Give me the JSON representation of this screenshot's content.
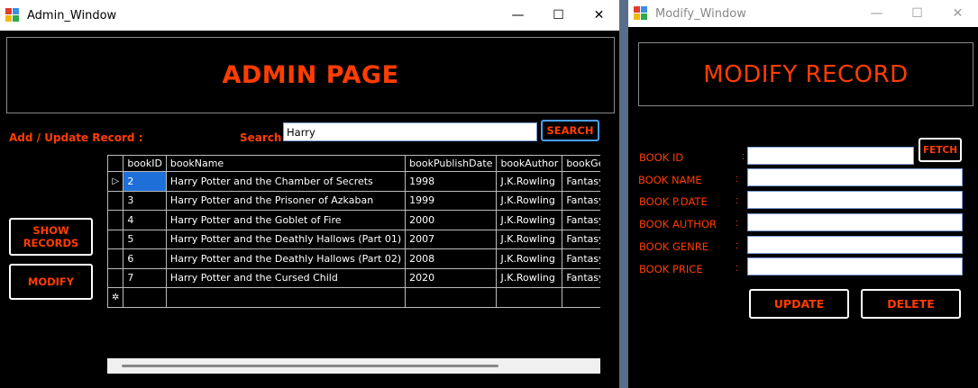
{
  "admin_window": {
    "title": "Admin_Window",
    "controls": {
      "minimize": "—",
      "maximize": "☐",
      "close": "✕"
    },
    "header_title": "ADMIN PAGE",
    "add_update_label": "Add / Update Record :",
    "search_label": "Search :",
    "search_value": "Harry",
    "search_button": "SEARCH",
    "show_records_button": "SHOW\nRECORDS",
    "modify_button": "MODIFY",
    "grid": {
      "columns": [
        "bookID",
        "bookName",
        "bookPublishDate",
        "bookAuthor",
        "bookGenre"
      ],
      "rows": [
        [
          "2",
          "Harry Potter and the Chamber of Secrets",
          "1998",
          "J.K.Rowling",
          "Fantasy"
        ],
        [
          "3",
          "Harry Potter and the Prisoner of Azkaban",
          "1999",
          "J.K.Rowling",
          "Fantasy"
        ],
        [
          "4",
          "Harry Potter and the Goblet of Fire",
          "2000",
          "J.K.Rowling",
          "Fantasy"
        ],
        [
          "5",
          "Harry Potter and the Deathly Hallows (Part 01)",
          "2007",
          "J.K.Rowling",
          "Fantasy"
        ],
        [
          "6",
          "Harry Potter and the Deathly Hallows (Part 02)",
          "2008",
          "J.K.Rowling",
          "Fantasy"
        ],
        [
          "7",
          "Harry Potter and the Cursed Child",
          "2020",
          "J.K.Rowling",
          "Fantasy"
        ]
      ],
      "current_row_marker": "▷",
      "new_row_marker": "✲"
    }
  },
  "modify_window": {
    "title": "Modify_Window",
    "controls": {
      "minimize": "—",
      "maximize": "☐",
      "close": "✕"
    },
    "header_title": "MODIFY RECORD",
    "fields": [
      {
        "label": "BOOK ID",
        "value": ""
      },
      {
        "label": "BOOK NAME",
        "value": ""
      },
      {
        "label": "BOOK P.DATE",
        "value": ""
      },
      {
        "label": "BOOK AUTHOR",
        "value": ""
      },
      {
        "label": "BOOK GENRE",
        "value": ""
      },
      {
        "label": "BOOK PRICE",
        "value": ""
      }
    ],
    "colon": ":",
    "fetch_button": "FETCH",
    "update_button": "UPDATE",
    "delete_button": "DELETE"
  },
  "colors": {
    "accent": "#ff3d00",
    "background": "#000000",
    "selection": "#1e6fd8",
    "search_border": "#4aa0ff"
  }
}
